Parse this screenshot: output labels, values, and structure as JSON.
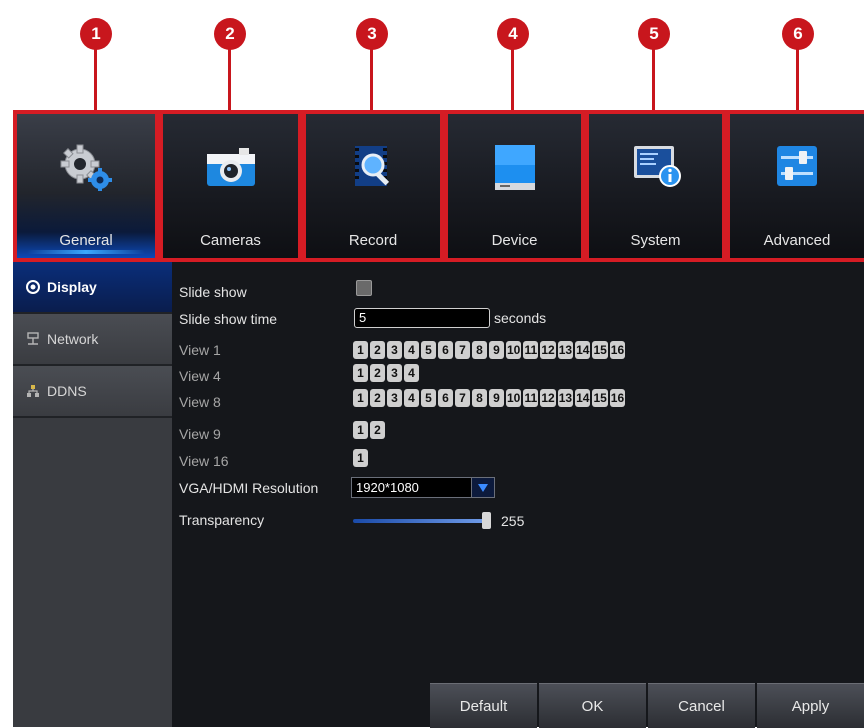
{
  "callouts": [
    "1",
    "2",
    "3",
    "4",
    "5",
    "6"
  ],
  "tabs": [
    {
      "label": "General",
      "icon": "gears-icon",
      "active": true
    },
    {
      "label": "Cameras",
      "icon": "camera-icon",
      "active": false
    },
    {
      "label": "Record",
      "icon": "record-search-icon",
      "active": false
    },
    {
      "label": "Device",
      "icon": "hard-drive-icon",
      "active": false
    },
    {
      "label": "System",
      "icon": "system-info-icon",
      "active": false
    },
    {
      "label": "Advanced",
      "icon": "sliders-icon",
      "active": false
    }
  ],
  "sidebar": {
    "items": [
      {
        "label": "Display",
        "icon": "display-icon",
        "active": true
      },
      {
        "label": "Network",
        "icon": "network-icon",
        "active": false
      },
      {
        "label": "DDNS",
        "icon": "ddns-icon",
        "active": false
      }
    ]
  },
  "form": {
    "slide_show_label": "Slide show",
    "slide_show_checked": false,
    "slide_show_time_label": "Slide show time",
    "slide_show_time_value": "5",
    "slide_show_time_units": "seconds",
    "view1_label": "View 1",
    "view1_channels": [
      "1",
      "2",
      "3",
      "4",
      "5",
      "6",
      "7",
      "8",
      "9",
      "10",
      "11",
      "12",
      "13",
      "14",
      "15",
      "16"
    ],
    "view4_label": "View 4",
    "view4_channels": [
      "1",
      "2",
      "3",
      "4"
    ],
    "view8_label": "View 8",
    "view8_channels": [
      "1",
      "2",
      "3",
      "4",
      "5",
      "6",
      "7",
      "8",
      "9",
      "10",
      "11",
      "12",
      "13",
      "14",
      "15",
      "16"
    ],
    "view9_label": "View 9",
    "view9_channels": [
      "1",
      "2"
    ],
    "view16_label": "View 16",
    "view16_channels": [
      "1"
    ],
    "resolution_label": "VGA/HDMI Resolution",
    "resolution_value": "1920*1080",
    "transparency_label": "Transparency",
    "transparency_value": "255",
    "transparency_fraction": 1.0
  },
  "buttons": {
    "default": "Default",
    "ok": "OK",
    "cancel": "Cancel",
    "apply": "Apply"
  },
  "colors": {
    "highlight": "#d51c24",
    "accent_blue": "#0c49b8"
  }
}
